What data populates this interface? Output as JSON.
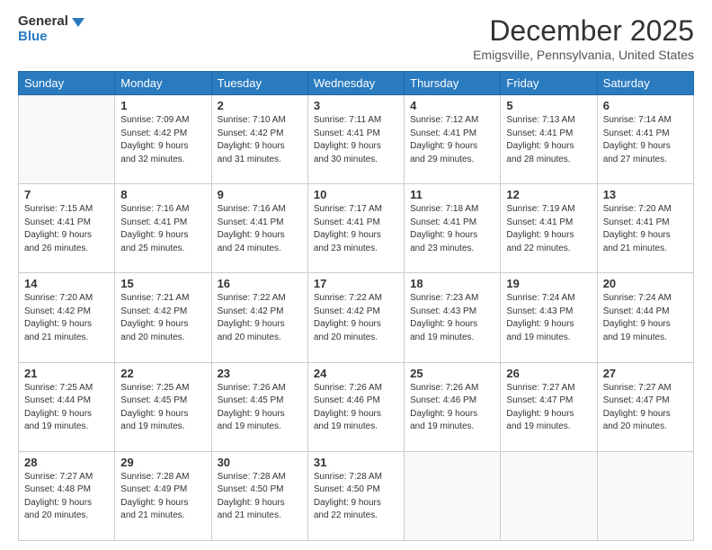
{
  "logo": {
    "line1": "General",
    "line2": "Blue"
  },
  "title": "December 2025",
  "location": "Emigsville, Pennsylvania, United States",
  "days_header": [
    "Sunday",
    "Monday",
    "Tuesday",
    "Wednesday",
    "Thursday",
    "Friday",
    "Saturday"
  ],
  "weeks": [
    [
      {
        "num": "",
        "info": ""
      },
      {
        "num": "1",
        "info": "Sunrise: 7:09 AM\nSunset: 4:42 PM\nDaylight: 9 hours\nand 32 minutes."
      },
      {
        "num": "2",
        "info": "Sunrise: 7:10 AM\nSunset: 4:42 PM\nDaylight: 9 hours\nand 31 minutes."
      },
      {
        "num": "3",
        "info": "Sunrise: 7:11 AM\nSunset: 4:41 PM\nDaylight: 9 hours\nand 30 minutes."
      },
      {
        "num": "4",
        "info": "Sunrise: 7:12 AM\nSunset: 4:41 PM\nDaylight: 9 hours\nand 29 minutes."
      },
      {
        "num": "5",
        "info": "Sunrise: 7:13 AM\nSunset: 4:41 PM\nDaylight: 9 hours\nand 28 minutes."
      },
      {
        "num": "6",
        "info": "Sunrise: 7:14 AM\nSunset: 4:41 PM\nDaylight: 9 hours\nand 27 minutes."
      }
    ],
    [
      {
        "num": "7",
        "info": "Sunrise: 7:15 AM\nSunset: 4:41 PM\nDaylight: 9 hours\nand 26 minutes."
      },
      {
        "num": "8",
        "info": "Sunrise: 7:16 AM\nSunset: 4:41 PM\nDaylight: 9 hours\nand 25 minutes."
      },
      {
        "num": "9",
        "info": "Sunrise: 7:16 AM\nSunset: 4:41 PM\nDaylight: 9 hours\nand 24 minutes."
      },
      {
        "num": "10",
        "info": "Sunrise: 7:17 AM\nSunset: 4:41 PM\nDaylight: 9 hours\nand 23 minutes."
      },
      {
        "num": "11",
        "info": "Sunrise: 7:18 AM\nSunset: 4:41 PM\nDaylight: 9 hours\nand 23 minutes."
      },
      {
        "num": "12",
        "info": "Sunrise: 7:19 AM\nSunset: 4:41 PM\nDaylight: 9 hours\nand 22 minutes."
      },
      {
        "num": "13",
        "info": "Sunrise: 7:20 AM\nSunset: 4:41 PM\nDaylight: 9 hours\nand 21 minutes."
      }
    ],
    [
      {
        "num": "14",
        "info": "Sunrise: 7:20 AM\nSunset: 4:42 PM\nDaylight: 9 hours\nand 21 minutes."
      },
      {
        "num": "15",
        "info": "Sunrise: 7:21 AM\nSunset: 4:42 PM\nDaylight: 9 hours\nand 20 minutes."
      },
      {
        "num": "16",
        "info": "Sunrise: 7:22 AM\nSunset: 4:42 PM\nDaylight: 9 hours\nand 20 minutes."
      },
      {
        "num": "17",
        "info": "Sunrise: 7:22 AM\nSunset: 4:42 PM\nDaylight: 9 hours\nand 20 minutes."
      },
      {
        "num": "18",
        "info": "Sunrise: 7:23 AM\nSunset: 4:43 PM\nDaylight: 9 hours\nand 19 minutes."
      },
      {
        "num": "19",
        "info": "Sunrise: 7:24 AM\nSunset: 4:43 PM\nDaylight: 9 hours\nand 19 minutes."
      },
      {
        "num": "20",
        "info": "Sunrise: 7:24 AM\nSunset: 4:44 PM\nDaylight: 9 hours\nand 19 minutes."
      }
    ],
    [
      {
        "num": "21",
        "info": "Sunrise: 7:25 AM\nSunset: 4:44 PM\nDaylight: 9 hours\nand 19 minutes."
      },
      {
        "num": "22",
        "info": "Sunrise: 7:25 AM\nSunset: 4:45 PM\nDaylight: 9 hours\nand 19 minutes."
      },
      {
        "num": "23",
        "info": "Sunrise: 7:26 AM\nSunset: 4:45 PM\nDaylight: 9 hours\nand 19 minutes."
      },
      {
        "num": "24",
        "info": "Sunrise: 7:26 AM\nSunset: 4:46 PM\nDaylight: 9 hours\nand 19 minutes."
      },
      {
        "num": "25",
        "info": "Sunrise: 7:26 AM\nSunset: 4:46 PM\nDaylight: 9 hours\nand 19 minutes."
      },
      {
        "num": "26",
        "info": "Sunrise: 7:27 AM\nSunset: 4:47 PM\nDaylight: 9 hours\nand 19 minutes."
      },
      {
        "num": "27",
        "info": "Sunrise: 7:27 AM\nSunset: 4:47 PM\nDaylight: 9 hours\nand 20 minutes."
      }
    ],
    [
      {
        "num": "28",
        "info": "Sunrise: 7:27 AM\nSunset: 4:48 PM\nDaylight: 9 hours\nand 20 minutes."
      },
      {
        "num": "29",
        "info": "Sunrise: 7:28 AM\nSunset: 4:49 PM\nDaylight: 9 hours\nand 21 minutes."
      },
      {
        "num": "30",
        "info": "Sunrise: 7:28 AM\nSunset: 4:50 PM\nDaylight: 9 hours\nand 21 minutes."
      },
      {
        "num": "31",
        "info": "Sunrise: 7:28 AM\nSunset: 4:50 PM\nDaylight: 9 hours\nand 22 minutes."
      },
      {
        "num": "",
        "info": ""
      },
      {
        "num": "",
        "info": ""
      },
      {
        "num": "",
        "info": ""
      }
    ]
  ]
}
